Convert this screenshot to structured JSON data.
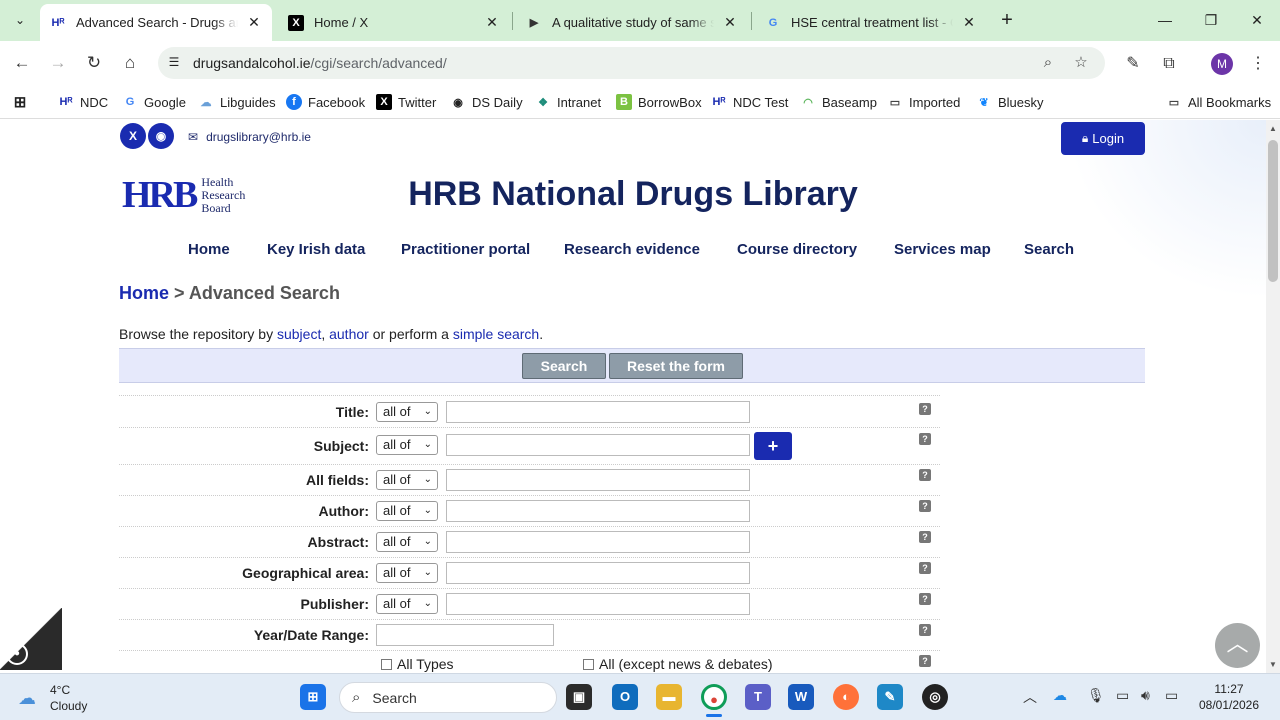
{
  "browser": {
    "tabs": [
      {
        "title": "Advanced Search - Drugs and Alcohol",
        "favicon": "hrb-favicon",
        "active": true
      },
      {
        "title": "Home / X",
        "favicon": "x-favicon",
        "active": false
      },
      {
        "title": "A qualitative study of same sex",
        "favicon": "document-favicon",
        "active": false
      },
      {
        "title": "HSE central treatment list - Google",
        "favicon": "google-favicon",
        "active": false
      }
    ],
    "url_host": "drugsandalcohol.ie",
    "url_path": "/cgi/search/advanced/",
    "profile_initial": "M",
    "bookmarks": [
      {
        "label": "NDC",
        "icon": "hrb-icon"
      },
      {
        "label": "Google",
        "icon": "google-icon"
      },
      {
        "label": "Libguides",
        "icon": "cloud-icon"
      },
      {
        "label": "Facebook",
        "icon": "facebook-icon"
      },
      {
        "label": "Twitter",
        "icon": "x-icon"
      },
      {
        "label": "DS Daily",
        "icon": "globe-icon"
      },
      {
        "label": "Intranet",
        "icon": "intranet-icon"
      },
      {
        "label": "BorrowBox",
        "icon": "borrowbox-icon"
      },
      {
        "label": "NDC Test",
        "icon": "hrb-icon"
      },
      {
        "label": "Baseamp",
        "icon": "basecamp-icon"
      },
      {
        "label": "Imported",
        "icon": "folder-icon"
      },
      {
        "label": "Bluesky",
        "icon": "butterfly-icon"
      }
    ],
    "all_bookmarks": "All Bookmarks"
  },
  "site": {
    "email": "drugslibrary@hrb.ie",
    "login": "Login",
    "logo_mark": "HRB",
    "logo_lines": [
      "Health",
      "Research",
      "Board"
    ],
    "title": "HRB National Drugs Library",
    "nav": [
      "Home",
      "Key Irish data",
      "Practitioner portal",
      "Research evidence",
      "Course directory",
      "Services map",
      "Search"
    ],
    "breadcrumb_home": "Home",
    "breadcrumb_sep": " > ",
    "breadcrumb_current": "Advanced Search",
    "browse": {
      "prefix": "Browse the repository by ",
      "subject": "subject",
      "comma": ", ",
      "author": "author",
      "middle": " or perform a ",
      "simple": "simple search",
      "suffix": "."
    },
    "search_button": "Search",
    "reset_button": "Reset the form"
  },
  "form": {
    "fields": [
      {
        "label": "Title:",
        "match": "all of",
        "value": ""
      },
      {
        "label": "Subject:",
        "match": "all of",
        "value": ""
      },
      {
        "label": "All fields:",
        "match": "all of",
        "value": ""
      },
      {
        "label": "Author:",
        "match": "all of",
        "value": ""
      },
      {
        "label": "Abstract:",
        "match": "all of",
        "value": ""
      },
      {
        "label": "Geographical area:",
        "match": "all of",
        "value": ""
      },
      {
        "label": "Publisher:",
        "match": "all of",
        "value": ""
      }
    ],
    "date_label": "Year/Date Range:",
    "date_value": "",
    "help_glyph": "?",
    "add_glyph": "+",
    "type_options": [
      "All Types",
      "All (except news & debates)"
    ]
  },
  "taskbar": {
    "temperature": "4°C",
    "condition": "Cloudy",
    "search_placeholder": "Search",
    "time": "11:27",
    "date": "08/01/2026"
  },
  "colors": {
    "brand_blue": "#1a2bb0",
    "title_navy": "#14245e",
    "tabstrip": "#d4efd6"
  }
}
